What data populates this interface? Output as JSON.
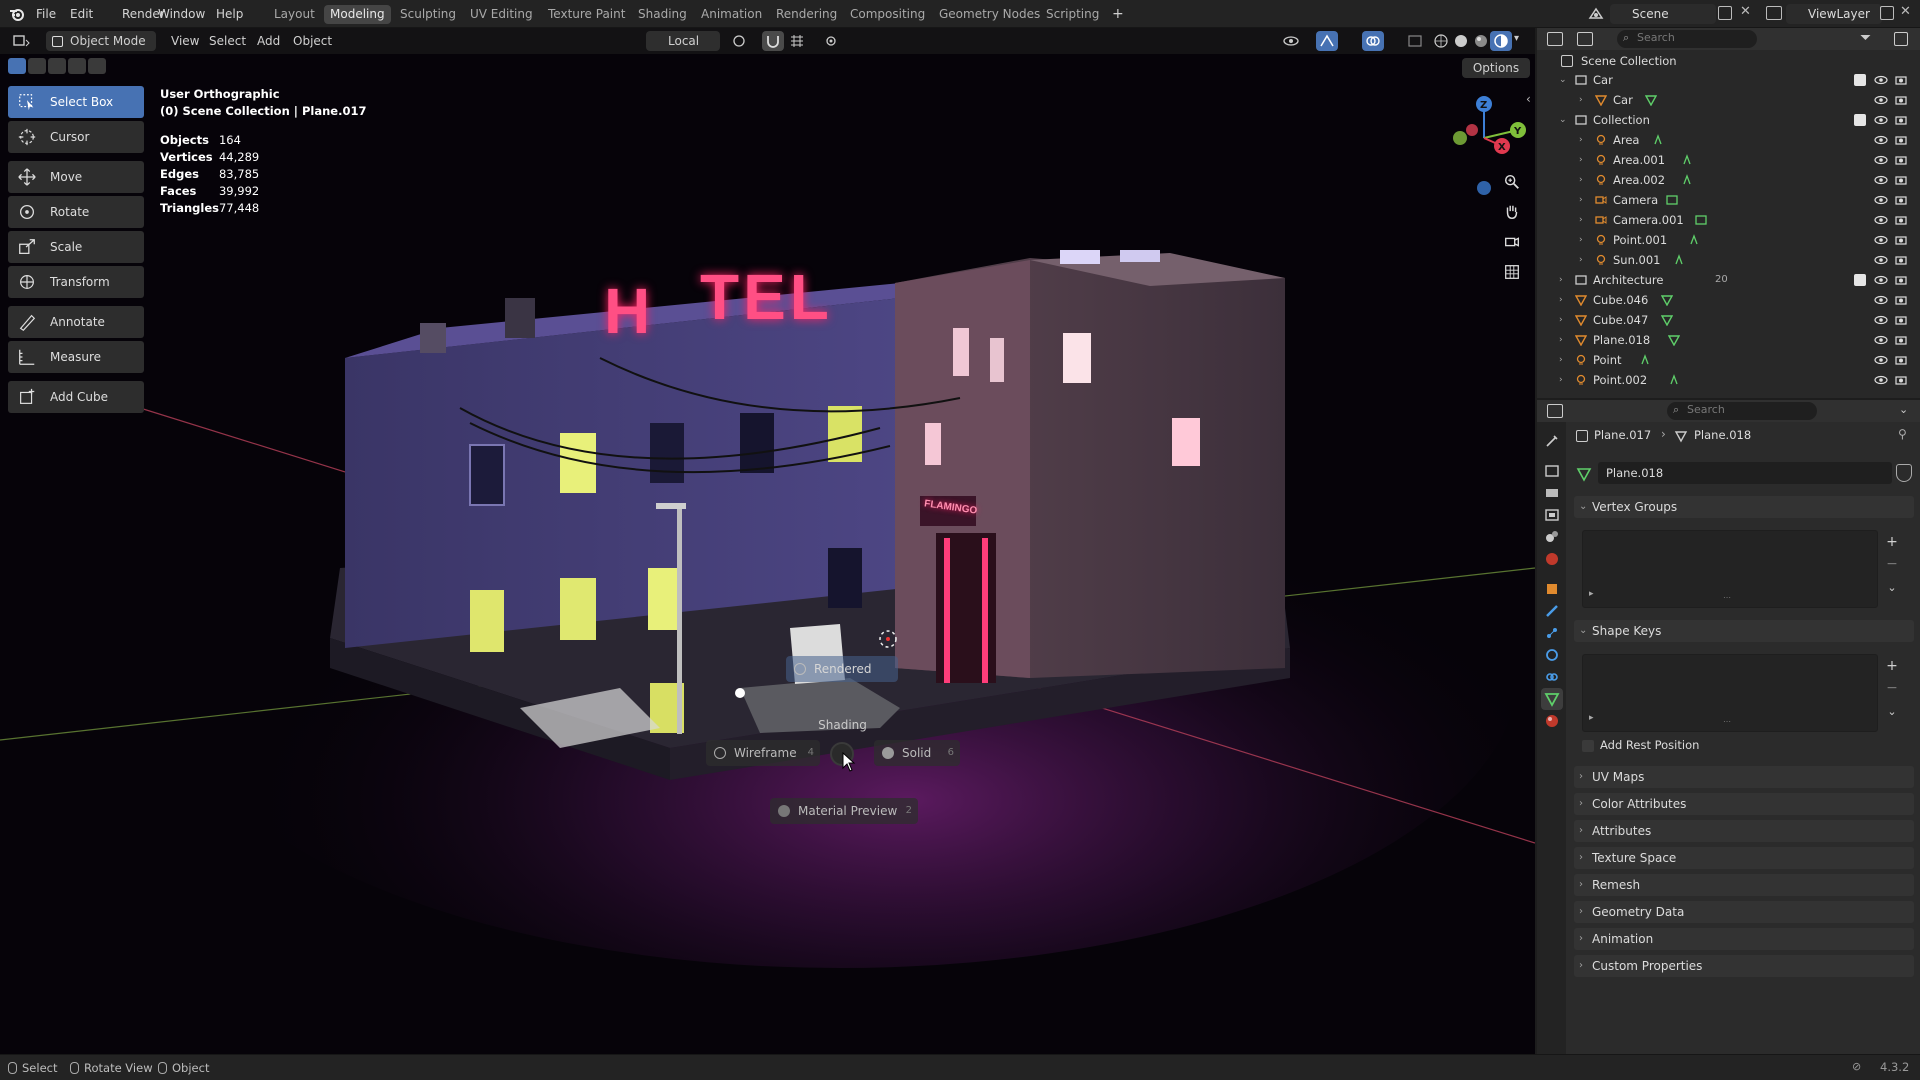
{
  "menu": {
    "items": [
      "File",
      "Edit",
      "Render",
      "Window",
      "Help"
    ]
  },
  "workspaces": {
    "tabs": [
      "Layout",
      "Modeling",
      "Sculpting",
      "UV Editing",
      "Texture Paint",
      "Shading",
      "Animation",
      "Rendering",
      "Compositing",
      "Geometry Nodes",
      "Scripting"
    ],
    "active": "Modeling",
    "add_label": "+"
  },
  "scene_field": "Scene",
  "viewlayer_field": "ViewLayer",
  "viewport_header": {
    "mode": "Object Mode",
    "menus": [
      "View",
      "Select",
      "Add",
      "Object"
    ],
    "orientation": "Local",
    "options": "Options"
  },
  "toolbar": {
    "tools": [
      "Select Box",
      "Cursor",
      "Move",
      "Rotate",
      "Scale",
      "Transform",
      "Annotate",
      "Measure",
      "Add Cube"
    ],
    "active": "Select Box"
  },
  "viewport_info": {
    "view": "User Orthographic",
    "context": "(0) Scene Collection | Plane.017"
  },
  "stats": [
    {
      "label": "Objects",
      "value": "164"
    },
    {
      "label": "Vertices",
      "value": "44,289"
    },
    {
      "label": "Edges",
      "value": "83,785"
    },
    {
      "label": "Faces",
      "value": "39,992"
    },
    {
      "label": "Triangles",
      "value": "77,448"
    }
  ],
  "scene_text": {
    "hotel_sign_left": "H",
    "hotel_sign_right": "TEL",
    "flamingo_sign": "FLAMINGO"
  },
  "pie_menu": {
    "title": "Shading",
    "items": [
      {
        "label": "Rendered",
        "key": ""
      },
      {
        "label": "Wireframe",
        "key": "4"
      },
      {
        "label": "Solid",
        "key": "6"
      },
      {
        "label": "Material Preview",
        "key": "2"
      }
    ]
  },
  "gizmo": {
    "x": "X",
    "y": "Y",
    "z": "Z"
  },
  "outliner": {
    "search_placeholder": "Search",
    "root": "Scene Collection",
    "rows": [
      {
        "label": "Car",
        "kind": "collection"
      },
      {
        "label": "Car",
        "kind": "object"
      },
      {
        "label": "Collection",
        "kind": "collection"
      },
      {
        "label": "Area",
        "kind": "light"
      },
      {
        "label": "Area.001",
        "kind": "light"
      },
      {
        "label": "Area.002",
        "kind": "light"
      },
      {
        "label": "Camera",
        "kind": "camera"
      },
      {
        "label": "Camera.001",
        "kind": "camera"
      },
      {
        "label": "Point.001",
        "kind": "light"
      },
      {
        "label": "Sun.001",
        "kind": "light"
      },
      {
        "label": "Architecture",
        "kind": "collection"
      },
      {
        "label": "Cube.046",
        "kind": "mesh"
      },
      {
        "label": "Cube.047",
        "kind": "mesh"
      },
      {
        "label": "Plane.018",
        "kind": "mesh"
      },
      {
        "label": "Point",
        "kind": "light"
      },
      {
        "label": "Point.002",
        "kind": "light"
      }
    ],
    "architecture_badge": "20"
  },
  "properties": {
    "search_placeholder": "Search",
    "breadcrumb_object": "Plane.017",
    "breadcrumb_data": "Plane.018",
    "data_name": "Plane.018",
    "panels_open": [
      "Vertex Groups",
      "Shape Keys"
    ],
    "add_rest_position": "Add Rest Position",
    "panels_closed": [
      "UV Maps",
      "Color Attributes",
      "Attributes",
      "Texture Space",
      "Remesh",
      "Geometry Data",
      "Animation",
      "Custom Properties"
    ]
  },
  "statusbar": {
    "items": [
      "Select",
      "Rotate View",
      "Object"
    ],
    "version": "4.3.2"
  },
  "colors": {
    "accent": "#4772b3",
    "neon_pink": "#ff3d7a",
    "window_yellow": "#e8f07a",
    "x_axis": "#e0394f",
    "y_axis": "#7fbf3a",
    "z_axis": "#3d7fd6"
  }
}
